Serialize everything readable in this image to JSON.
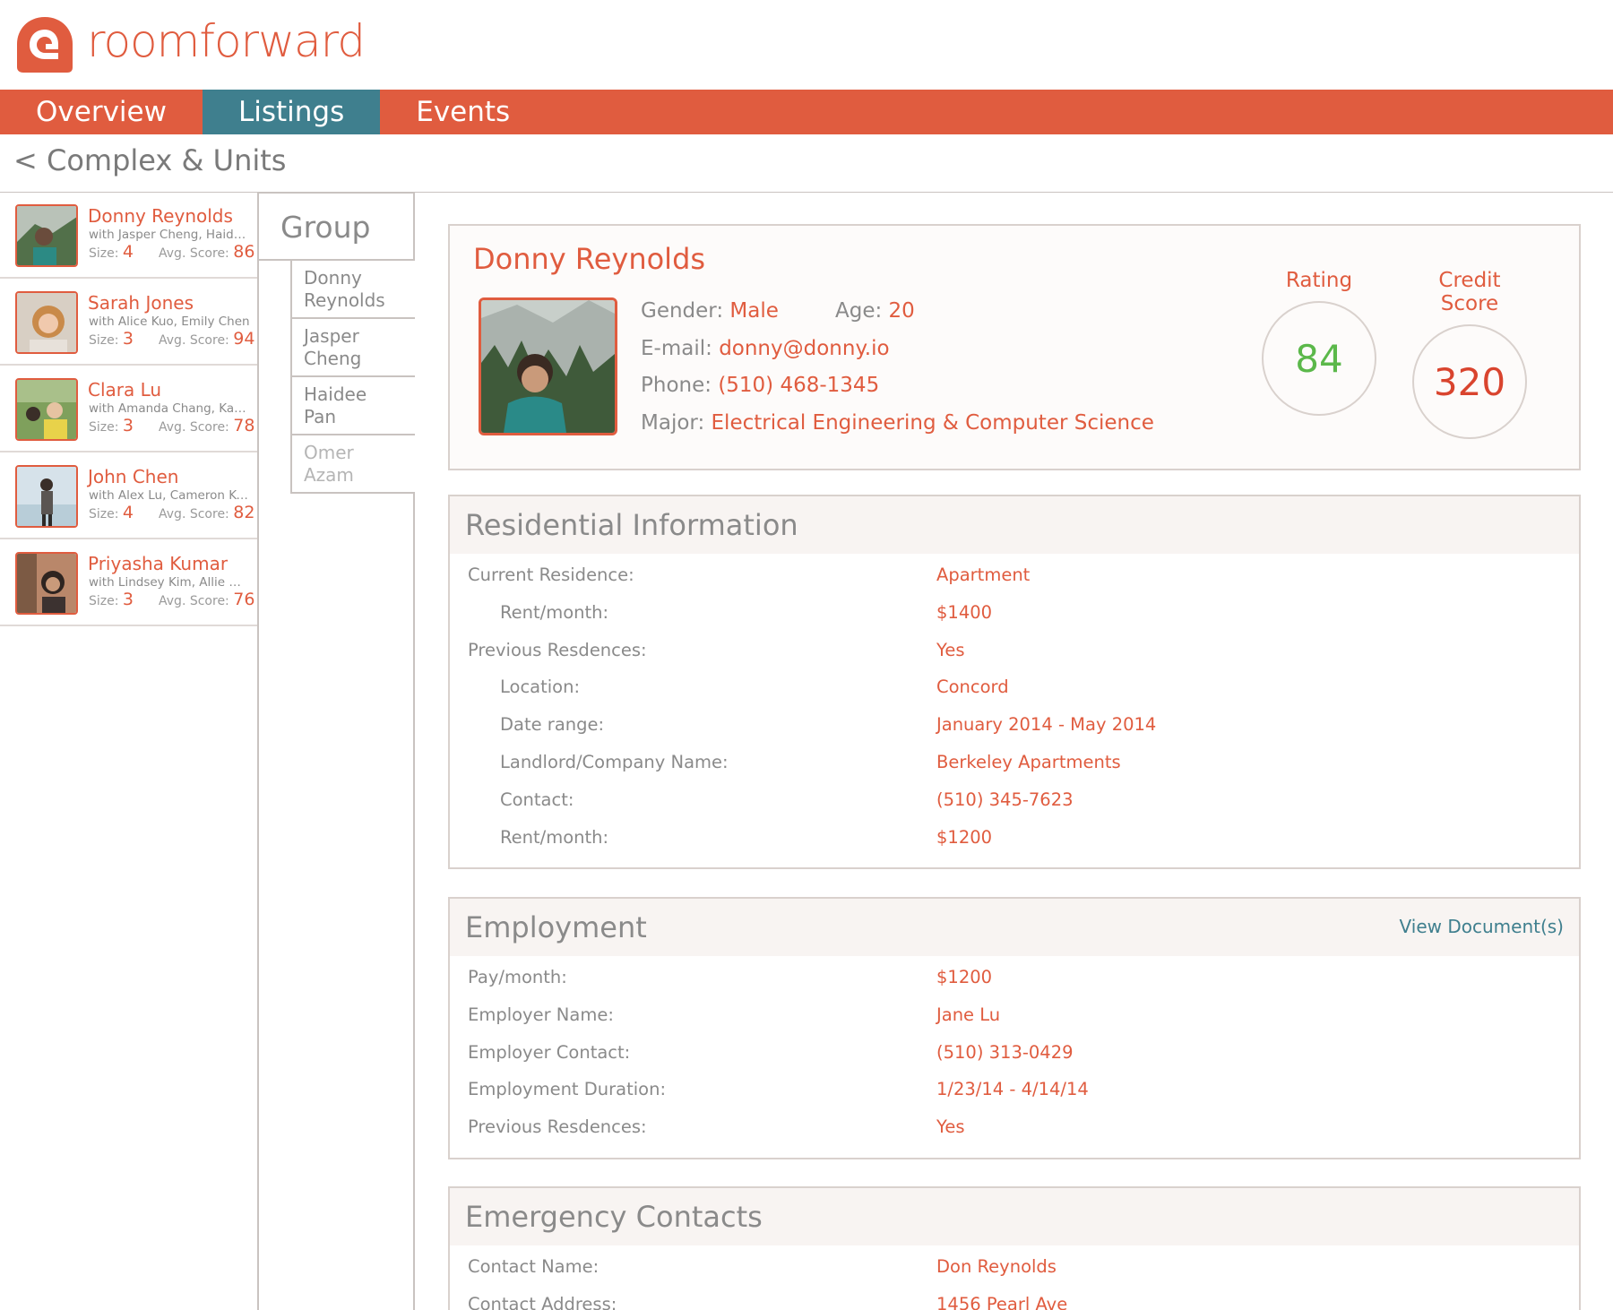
{
  "brand": {
    "name": "roomforward",
    "accent": "#e05c3f",
    "teal": "#3f7f8e"
  },
  "nav": {
    "tabs": [
      {
        "label": "Overview",
        "active": false
      },
      {
        "label": "Listings",
        "active": true
      },
      {
        "label": "Events",
        "active": false
      }
    ]
  },
  "breadcrumb": "< Complex & Units",
  "applicants": [
    {
      "name": "Donny Reynolds",
      "with": "with Jasper Cheng, Haidee P...",
      "size_label": "Size:",
      "size": "4",
      "score_label": "Avg. Score:",
      "score": "86"
    },
    {
      "name": "Sarah Jones",
      "with": "with Alice Kuo, Emily Chen",
      "size_label": "Size:",
      "size": "3",
      "score_label": "Avg. Score:",
      "score": "94"
    },
    {
      "name": "Clara Lu",
      "with": "with Amanda Chang, Karen...",
      "size_label": "Size:",
      "size": "3",
      "score_label": "Avg. Score:",
      "score": "78"
    },
    {
      "name": "John Chen",
      "with": "with Alex Lu, Cameron Kob...",
      "size_label": "Size:",
      "size": "4",
      "score_label": "Avg. Score:",
      "score": "82"
    },
    {
      "name": "Priyasha Kumar",
      "with": "with Lindsey Kim, Allie Hsu",
      "size_label": "Size:",
      "size": "3",
      "score_label": "Avg. Score:",
      "score": "76"
    }
  ],
  "group": {
    "title": "Group",
    "members": [
      {
        "first": "Donny",
        "last": "Reynolds",
        "active": true
      },
      {
        "first": "Jasper",
        "last": "Cheng",
        "active": false
      },
      {
        "first": "Haidee",
        "last": "Pan",
        "active": false
      },
      {
        "first": "Omer",
        "last": "Azam",
        "active": false
      }
    ]
  },
  "profile": {
    "name": "Donny Reynolds",
    "gender_label": "Gender:",
    "gender": "Male",
    "age_label": "Age:",
    "age": "20",
    "email_label": "E-mail:",
    "email": "donny@donny.io",
    "phone_label": "Phone:",
    "phone": "(510) 468-1345",
    "major_label": "Major:",
    "major": "Electrical Engineering & Computer Science",
    "rating_label": "Rating",
    "rating": "84",
    "rating_color": "#5bb84a",
    "credit_label": "Credit Score",
    "credit": "320",
    "credit_color": "#d9442e"
  },
  "residential": {
    "title": "Residential Information",
    "rows": [
      {
        "label": "Current Residence:",
        "value": "Apartment",
        "indent": false
      },
      {
        "label": "Rent/month:",
        "value": "$1400",
        "indent": true
      },
      {
        "label": "Previous Resdences:",
        "value": "Yes",
        "indent": false
      },
      {
        "label": "Location:",
        "value": "Concord",
        "indent": true
      },
      {
        "label": "Date range:",
        "value": "January 2014 - May 2014",
        "indent": true
      },
      {
        "label": "Landlord/Company Name:",
        "value": "Berkeley Apartments",
        "indent": true
      },
      {
        "label": "Contact:",
        "value": "(510) 345-7623",
        "indent": true
      },
      {
        "label": "Rent/month:",
        "value": "$1200",
        "indent": true
      }
    ]
  },
  "employment": {
    "title": "Employment",
    "action": "View Document(s)",
    "rows": [
      {
        "label": "Pay/month:",
        "value": "$1200"
      },
      {
        "label": "Employer Name:",
        "value": "Jane Lu"
      },
      {
        "label": "Employer Contact:",
        "value": "(510) 313-0429"
      },
      {
        "label": "Employment Duration:",
        "value": "1/23/14 - 4/14/14"
      },
      {
        "label": "Previous Resdences:",
        "value": "Yes"
      }
    ]
  },
  "emergency": {
    "title": "Emergency Contacts",
    "rows": [
      {
        "label": "Contact Name:",
        "value": "Don Reynolds"
      },
      {
        "label": "Contact Address:",
        "value": "1456 Pearl Ave"
      }
    ]
  }
}
